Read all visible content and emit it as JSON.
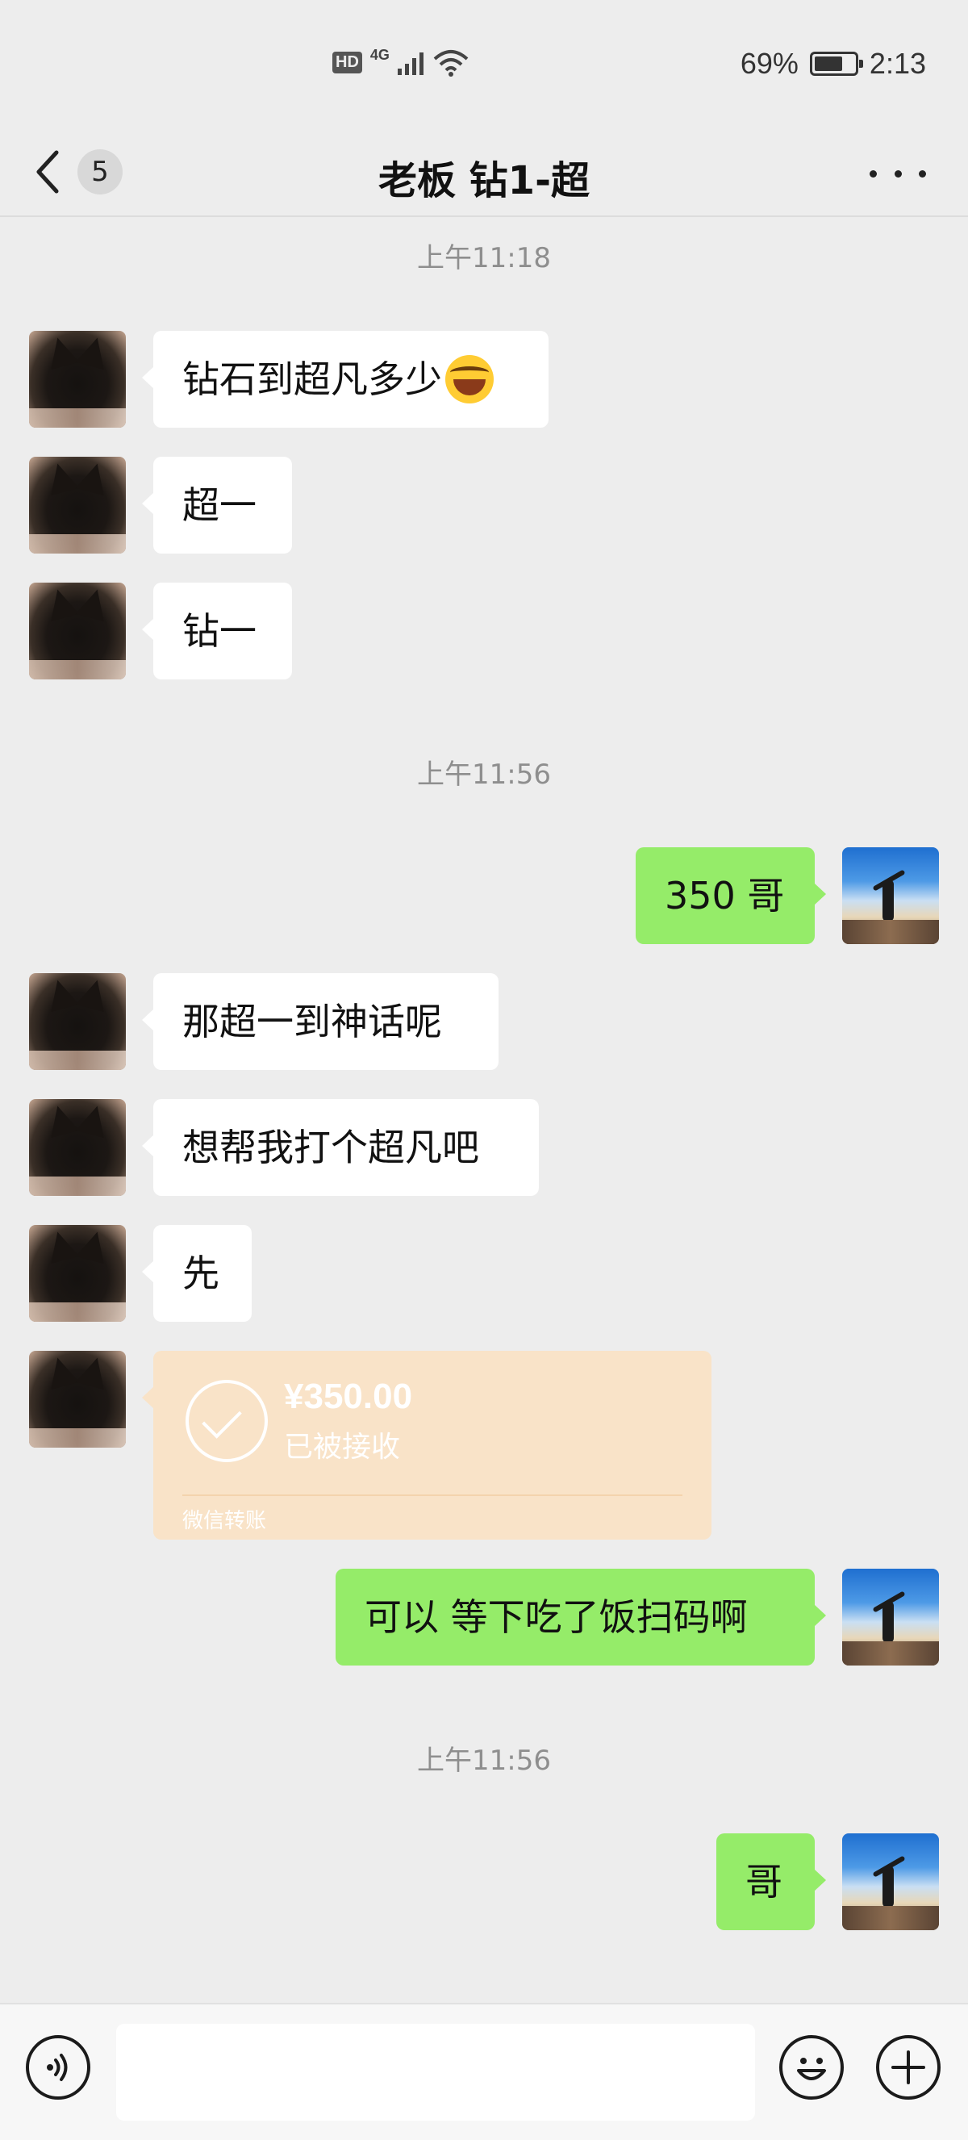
{
  "status_bar": {
    "network_hd": "HD",
    "network_type": "4G",
    "battery": "69%",
    "battery_level": 0.69,
    "time": "2:13"
  },
  "nav": {
    "unread_count": "5",
    "title": "老板 钻1-超",
    "icons": {
      "back": "chevron-left-icon",
      "more": "ellipsis-icon"
    }
  },
  "messages": [
    {
      "type": "timestamp",
      "text": "上午11:18"
    },
    {
      "type": "text",
      "side": "in",
      "text": "钻石到超凡多少",
      "emoji": "joy-emoji"
    },
    {
      "type": "text",
      "side": "in",
      "text": "超一"
    },
    {
      "type": "text",
      "side": "in",
      "text": "钻一"
    },
    {
      "type": "timestamp",
      "text": "上午11:56"
    },
    {
      "type": "text",
      "side": "out",
      "text": "350 哥"
    },
    {
      "type": "text",
      "side": "in",
      "text": "那超一到神话呢"
    },
    {
      "type": "text",
      "side": "in",
      "text": "想帮我打个超凡吧"
    },
    {
      "type": "text",
      "side": "in",
      "text": "先"
    },
    {
      "type": "transfer",
      "side": "in",
      "amount": "¥350.00",
      "status": "已被接收",
      "label": "微信转账"
    },
    {
      "type": "text",
      "side": "out",
      "text": "可以 等下吃了饭扫码啊"
    },
    {
      "type": "timestamp",
      "text": "上午11:56"
    },
    {
      "type": "text",
      "side": "out",
      "text": "哥"
    }
  ],
  "input_bar": {
    "value": "",
    "icons": {
      "voice": "voice-icon",
      "emoji": "smiley-icon",
      "more": "plus-circle-icon"
    }
  },
  "colors": {
    "background": "#ededed",
    "incoming_bubble": "#ffffff",
    "outgoing_bubble": "#95ec69",
    "transfer_card": "#f9e3c8",
    "timestamp_text": "#8e8e8e"
  }
}
